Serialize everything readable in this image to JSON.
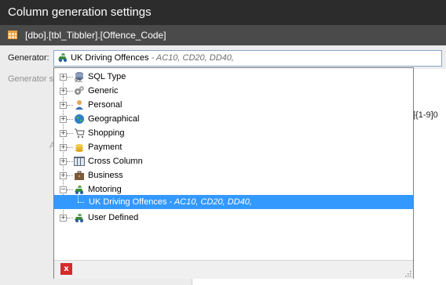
{
  "window": {
    "title": "Column generation settings"
  },
  "path": {
    "text": "[dbo].[tbl_Tibbler].[Offence_Code]"
  },
  "generator": {
    "label": "Generator:",
    "value": "UK Driving Offences",
    "description": " - AC10, CD20, DD40,"
  },
  "generator_settings_label": "Generator s",
  "faint_letter": "A",
  "right_fragment": "]{1-9]0",
  "tree": {
    "items": [
      {
        "label": "SQL Type",
        "icon": "sql-type-icon"
      },
      {
        "label": "Generic",
        "icon": "generic-icon"
      },
      {
        "label": "Personal",
        "icon": "person-icon"
      },
      {
        "label": "Geographical",
        "icon": "globe-icon"
      },
      {
        "label": "Shopping",
        "icon": "shopping-cart-icon"
      },
      {
        "label": "Payment",
        "icon": "coins-icon"
      },
      {
        "label": "Cross Column",
        "icon": "cross-column-icon"
      },
      {
        "label": "Business",
        "icon": "briefcase-icon"
      },
      {
        "label": "Motoring",
        "icon": "motoring-icon",
        "expanded": true
      },
      {
        "label": "User Defined",
        "icon": "user-defined-icon"
      }
    ],
    "selected_child": {
      "label": "UK Driving Offences",
      "description": " - AC10, CD20, DD40,"
    },
    "expand_symbol": "+",
    "collapse_symbol": "−"
  },
  "footer": {
    "close_label": "x"
  },
  "colors": {
    "titlebar": "#2c2c2c",
    "pathbar": "#4a4a4a",
    "selection": "#3399ff",
    "close_button": "#d42c2c"
  }
}
